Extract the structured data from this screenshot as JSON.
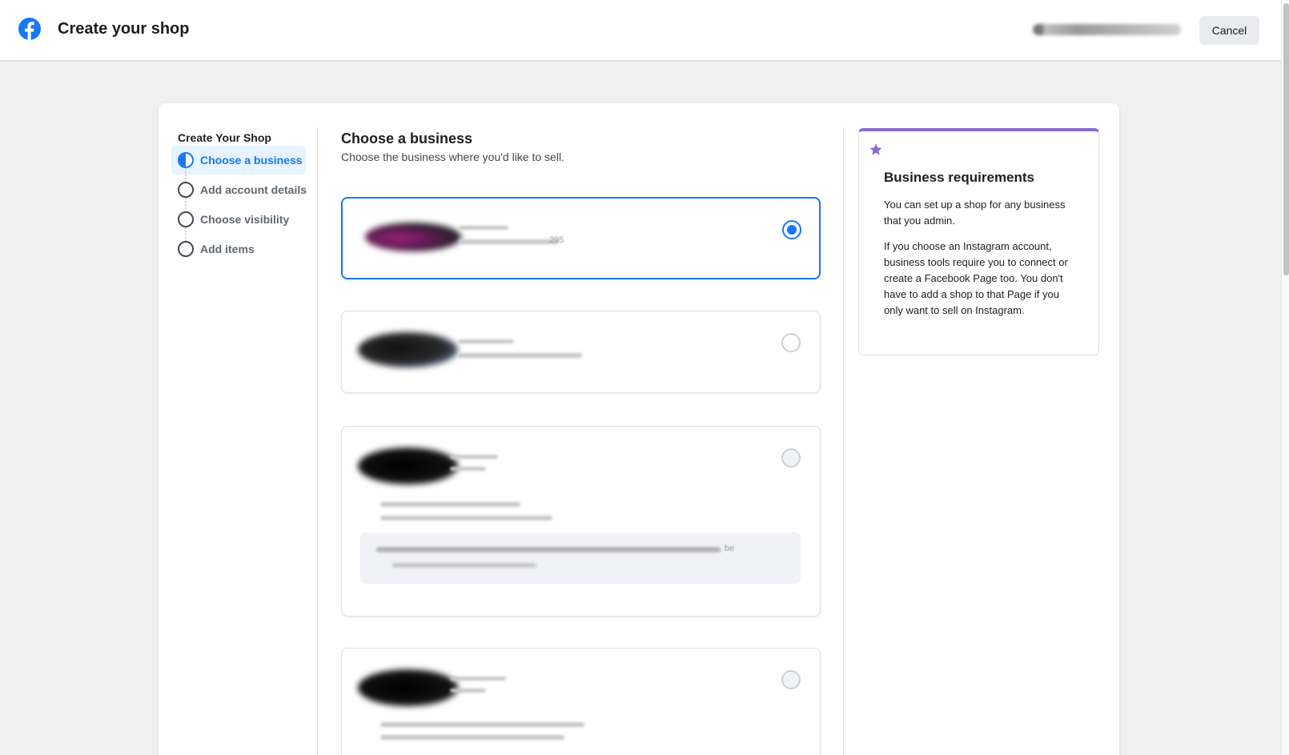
{
  "header": {
    "title": "Create your shop",
    "cancel_label": "Cancel"
  },
  "stepper": {
    "title": "Create Your Shop",
    "steps": [
      {
        "label": "Choose a business",
        "state": "in-progress"
      },
      {
        "label": "Add account details",
        "state": "pending"
      },
      {
        "label": "Choose visibility",
        "state": "pending"
      },
      {
        "label": "Add items",
        "state": "pending"
      }
    ]
  },
  "main": {
    "title": "Choose a business",
    "subtitle": "Choose the business where you'd like to sell.",
    "businesses": [
      {
        "selected": true,
        "visible_tail": "295"
      },
      {
        "selected": false
      },
      {
        "selected": false,
        "visible_tail": "be"
      },
      {
        "selected": false
      }
    ]
  },
  "requirements": {
    "icon": "star-icon",
    "title": "Business requirements",
    "paragraphs": [
      "You can set up a shop for any business that you admin.",
      "If you choose an Instagram account, business tools require you to connect or create a Facebook Page too. You don't have to add a shop to that Page if you only want to sell on Instagram."
    ]
  },
  "colors": {
    "brand": "#1877f2",
    "accent_purple": "#8a6bd1"
  }
}
